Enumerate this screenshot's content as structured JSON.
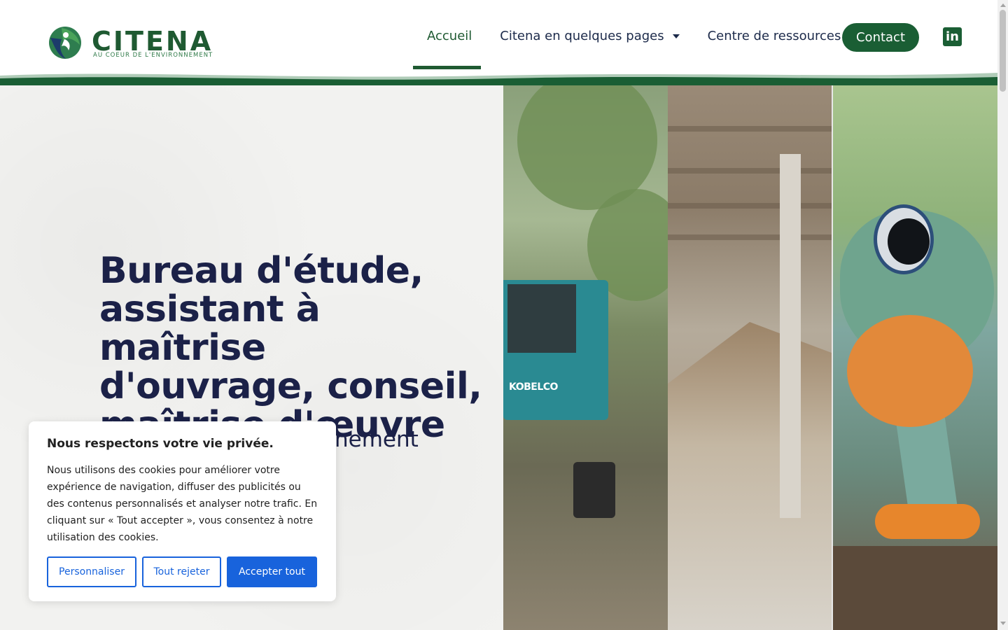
{
  "brand": {
    "name": "CITENA",
    "tagline": "AU COEUR DE L'ENVIRONNEMENT",
    "icon": "logo-leaf-globe-icon",
    "colors": {
      "primary": "#1a5e34",
      "navy": "#1b2148",
      "accent_blue": "#1863dc"
    }
  },
  "nav": {
    "items": [
      {
        "label": "Accueil",
        "active": true,
        "has_dropdown": false
      },
      {
        "label": "Citena en quelques pages",
        "active": false,
        "has_dropdown": true
      },
      {
        "label": "Centre de ressources",
        "active": false,
        "has_dropdown": true
      }
    ],
    "contact_label": "Contact",
    "social": {
      "icon": "linkedin-icon",
      "label": "in"
    }
  },
  "hero": {
    "title_lines": [
      "Bureau d'étude,",
      "assistant à maîtrise",
      "d'ouvrage, conseil,",
      "maîtrise d'œuvre"
    ],
    "subtitle_visible": "nement",
    "photos": [
      {
        "alt_icon": "excavator-photo",
        "overlay_text": "KOBELCO"
      },
      {
        "alt_icon": "waste-debris-photo"
      },
      {
        "alt_icon": "frog-photo"
      }
    ]
  },
  "cookie_banner": {
    "title": "Nous respectons votre vie privée.",
    "body": "Nous utilisons des cookies pour améliorer votre expérience de navigation, diffuser des publicités ou des contenus personnalisés et analyser notre trafic. En cliquant sur « Tout accepter », vous consentez à notre utilisation des cookies.",
    "buttons": {
      "customize": "Personnaliser",
      "reject": "Tout rejeter",
      "accept": "Accepter tout"
    }
  }
}
